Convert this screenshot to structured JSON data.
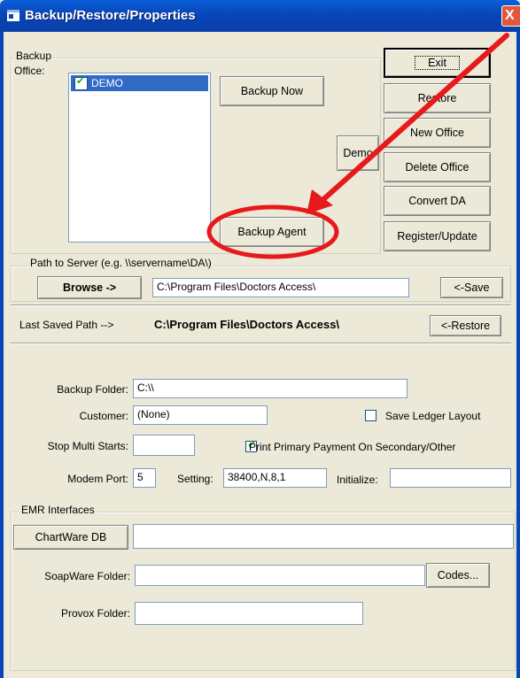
{
  "window": {
    "title": "Backup/Restore/Properties",
    "close_glyph": "X"
  },
  "backup": {
    "group_label": "Backup",
    "office_label": "Office:",
    "offices": [
      {
        "name": "DEMO",
        "checked": true
      }
    ],
    "backup_now": "Backup Now",
    "backup_agent": "Backup Agent",
    "demo": "Demo"
  },
  "side_buttons": {
    "exit": "Exit",
    "restore": "Restore",
    "new_office": "New Office",
    "delete_office": "Delete Office",
    "convert_da": "Convert DA",
    "register_update": "Register/Update"
  },
  "server_path": {
    "group_label": "Path to Server (e.g. \\\\servername\\DA\\)",
    "browse": "Browse ->",
    "path_value": "C:\\Program Files\\Doctors Access\\",
    "save": "<-Save",
    "last_saved_label": "Last Saved Path -->",
    "last_saved_value": "C:\\Program Files\\Doctors Access\\",
    "restore": "<-Restore"
  },
  "properties": {
    "backup_folder_label": "Backup Folder:",
    "backup_folder_value": "C:\\\\",
    "customer_label": "Customer:",
    "customer_value": "(None)",
    "save_ledger_label": "Save Ledger Layout",
    "stop_multi_label": "Stop Multi Starts:",
    "stop_multi_value": "",
    "print_primary_label": "Print Primary Payment On Secondary/Other",
    "modem_port_label": "Modem Port:",
    "modem_port_value": "5",
    "setting_label": "Setting:",
    "setting_value": "38400,N,8,1",
    "initialize_label": "Initialize:",
    "initialize_value": ""
  },
  "emr": {
    "group_label": "EMR Interfaces",
    "chartware_button": "ChartWare DB",
    "chartware_value": "",
    "soapware_label": "SoapWare Folder:",
    "soapware_value": "",
    "codes_button": "Codes...",
    "provox_label": "Provox Folder:",
    "provox_value": ""
  },
  "annotation": {
    "arrow_color": "#e8191b",
    "circle_color": "#e8191b"
  }
}
